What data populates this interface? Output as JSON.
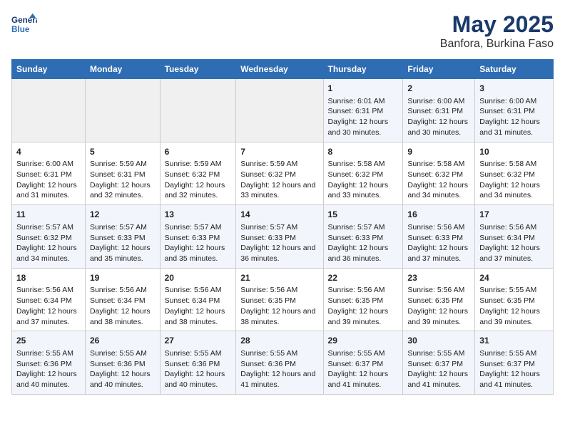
{
  "header": {
    "logo_line1": "General",
    "logo_line2": "Blue",
    "title": "May 2025",
    "subtitle": "Banfora, Burkina Faso"
  },
  "days_of_week": [
    "Sunday",
    "Monday",
    "Tuesday",
    "Wednesday",
    "Thursday",
    "Friday",
    "Saturday"
  ],
  "weeks": [
    [
      {
        "day": "",
        "info": ""
      },
      {
        "day": "",
        "info": ""
      },
      {
        "day": "",
        "info": ""
      },
      {
        "day": "",
        "info": ""
      },
      {
        "day": "1",
        "info": "Sunrise: 6:01 AM\nSunset: 6:31 PM\nDaylight: 12 hours\nand 30 minutes."
      },
      {
        "day": "2",
        "info": "Sunrise: 6:00 AM\nSunset: 6:31 PM\nDaylight: 12 hours\nand 30 minutes."
      },
      {
        "day": "3",
        "info": "Sunrise: 6:00 AM\nSunset: 6:31 PM\nDaylight: 12 hours\nand 31 minutes."
      }
    ],
    [
      {
        "day": "4",
        "info": "Sunrise: 6:00 AM\nSunset: 6:31 PM\nDaylight: 12 hours\nand 31 minutes."
      },
      {
        "day": "5",
        "info": "Sunrise: 5:59 AM\nSunset: 6:31 PM\nDaylight: 12 hours\nand 32 minutes."
      },
      {
        "day": "6",
        "info": "Sunrise: 5:59 AM\nSunset: 6:32 PM\nDaylight: 12 hours\nand 32 minutes."
      },
      {
        "day": "7",
        "info": "Sunrise: 5:59 AM\nSunset: 6:32 PM\nDaylight: 12 hours\nand 33 minutes."
      },
      {
        "day": "8",
        "info": "Sunrise: 5:58 AM\nSunset: 6:32 PM\nDaylight: 12 hours\nand 33 minutes."
      },
      {
        "day": "9",
        "info": "Sunrise: 5:58 AM\nSunset: 6:32 PM\nDaylight: 12 hours\nand 34 minutes."
      },
      {
        "day": "10",
        "info": "Sunrise: 5:58 AM\nSunset: 6:32 PM\nDaylight: 12 hours\nand 34 minutes."
      }
    ],
    [
      {
        "day": "11",
        "info": "Sunrise: 5:57 AM\nSunset: 6:32 PM\nDaylight: 12 hours\nand 34 minutes."
      },
      {
        "day": "12",
        "info": "Sunrise: 5:57 AM\nSunset: 6:33 PM\nDaylight: 12 hours\nand 35 minutes."
      },
      {
        "day": "13",
        "info": "Sunrise: 5:57 AM\nSunset: 6:33 PM\nDaylight: 12 hours\nand 35 minutes."
      },
      {
        "day": "14",
        "info": "Sunrise: 5:57 AM\nSunset: 6:33 PM\nDaylight: 12 hours\nand 36 minutes."
      },
      {
        "day": "15",
        "info": "Sunrise: 5:57 AM\nSunset: 6:33 PM\nDaylight: 12 hours\nand 36 minutes."
      },
      {
        "day": "16",
        "info": "Sunrise: 5:56 AM\nSunset: 6:33 PM\nDaylight: 12 hours\nand 37 minutes."
      },
      {
        "day": "17",
        "info": "Sunrise: 5:56 AM\nSunset: 6:34 PM\nDaylight: 12 hours\nand 37 minutes."
      }
    ],
    [
      {
        "day": "18",
        "info": "Sunrise: 5:56 AM\nSunset: 6:34 PM\nDaylight: 12 hours\nand 37 minutes."
      },
      {
        "day": "19",
        "info": "Sunrise: 5:56 AM\nSunset: 6:34 PM\nDaylight: 12 hours\nand 38 minutes."
      },
      {
        "day": "20",
        "info": "Sunrise: 5:56 AM\nSunset: 6:34 PM\nDaylight: 12 hours\nand 38 minutes."
      },
      {
        "day": "21",
        "info": "Sunrise: 5:56 AM\nSunset: 6:35 PM\nDaylight: 12 hours\nand 38 minutes."
      },
      {
        "day": "22",
        "info": "Sunrise: 5:56 AM\nSunset: 6:35 PM\nDaylight: 12 hours\nand 39 minutes."
      },
      {
        "day": "23",
        "info": "Sunrise: 5:56 AM\nSunset: 6:35 PM\nDaylight: 12 hours\nand 39 minutes."
      },
      {
        "day": "24",
        "info": "Sunrise: 5:55 AM\nSunset: 6:35 PM\nDaylight: 12 hours\nand 39 minutes."
      }
    ],
    [
      {
        "day": "25",
        "info": "Sunrise: 5:55 AM\nSunset: 6:36 PM\nDaylight: 12 hours\nand 40 minutes."
      },
      {
        "day": "26",
        "info": "Sunrise: 5:55 AM\nSunset: 6:36 PM\nDaylight: 12 hours\nand 40 minutes."
      },
      {
        "day": "27",
        "info": "Sunrise: 5:55 AM\nSunset: 6:36 PM\nDaylight: 12 hours\nand 40 minutes."
      },
      {
        "day": "28",
        "info": "Sunrise: 5:55 AM\nSunset: 6:36 PM\nDaylight: 12 hours\nand 41 minutes."
      },
      {
        "day": "29",
        "info": "Sunrise: 5:55 AM\nSunset: 6:37 PM\nDaylight: 12 hours\nand 41 minutes."
      },
      {
        "day": "30",
        "info": "Sunrise: 5:55 AM\nSunset: 6:37 PM\nDaylight: 12 hours\nand 41 minutes."
      },
      {
        "day": "31",
        "info": "Sunrise: 5:55 AM\nSunset: 6:37 PM\nDaylight: 12 hours\nand 41 minutes."
      }
    ]
  ]
}
